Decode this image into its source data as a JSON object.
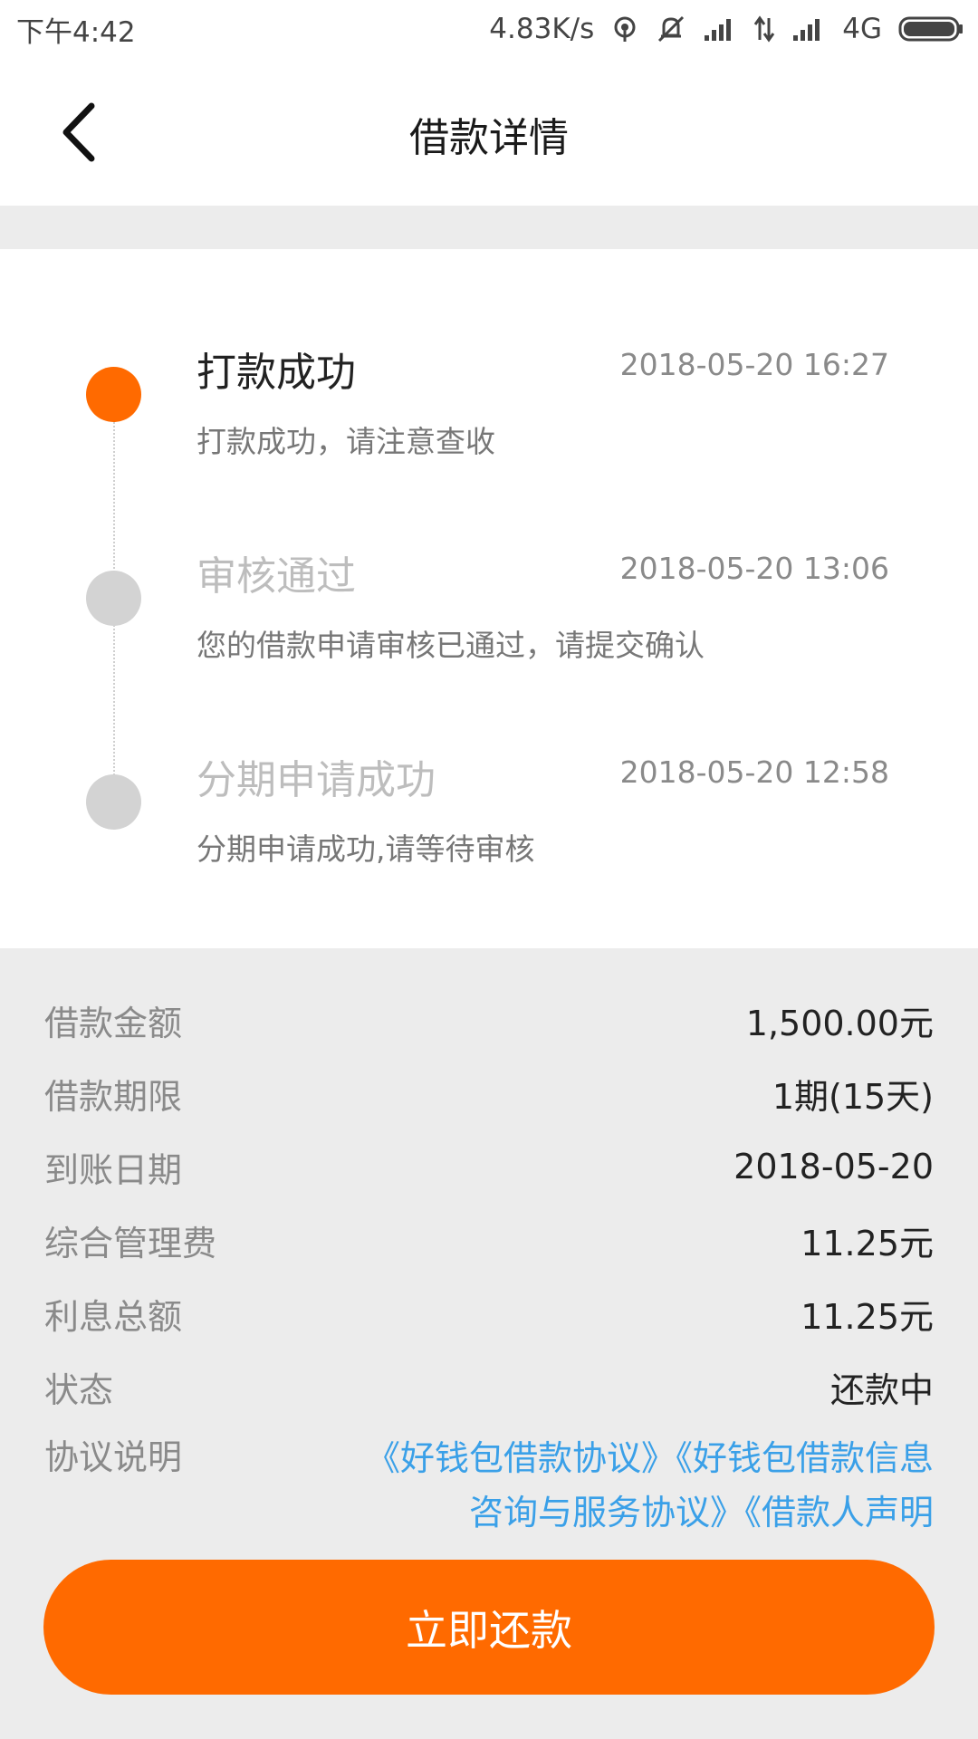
{
  "status_bar": {
    "time": "下午4:42",
    "net_speed": "4.83K/s",
    "network": "4G",
    "icons": [
      "hotspot-icon",
      "mute-icon",
      "signal-icon",
      "data-arrows-icon",
      "signal-icon",
      "battery-icon"
    ]
  },
  "nav": {
    "title": "借款详情",
    "back_icon": "chevron-left-icon"
  },
  "timeline": [
    {
      "title": "打款成功",
      "time": "2018-05-20 16:27",
      "desc": "打款成功，请注意查收",
      "active": true
    },
    {
      "title": "审核通过",
      "time": "2018-05-20 13:06",
      "desc": "您的借款申请审核已通过，请提交确认",
      "active": false
    },
    {
      "title": "分期申请成功",
      "time": "2018-05-20 12:58",
      "desc": "分期申请成功,请等待审核",
      "active": false
    }
  ],
  "details": [
    {
      "label": "借款金额",
      "value": "1,500.00元"
    },
    {
      "label": "借款期限",
      "value": "1期(15天)"
    },
    {
      "label": "到账日期",
      "value": "2018-05-20"
    },
    {
      "label": "综合管理费",
      "value": "11.25元"
    },
    {
      "label": "利息总额",
      "value": "11.25元"
    },
    {
      "label": "状态",
      "value": "还款中"
    }
  ],
  "agreement": {
    "label": "协议说明",
    "links": [
      "《好钱包借款协议》",
      "《好钱包借款信息咨询与服务协议》",
      "《借款人声明"
    ]
  },
  "colors": {
    "accent": "#ff6a00",
    "link": "#3aa0e8",
    "inactive_dot": "#d3d3d3"
  },
  "repay_button": {
    "label": "立即还款"
  }
}
